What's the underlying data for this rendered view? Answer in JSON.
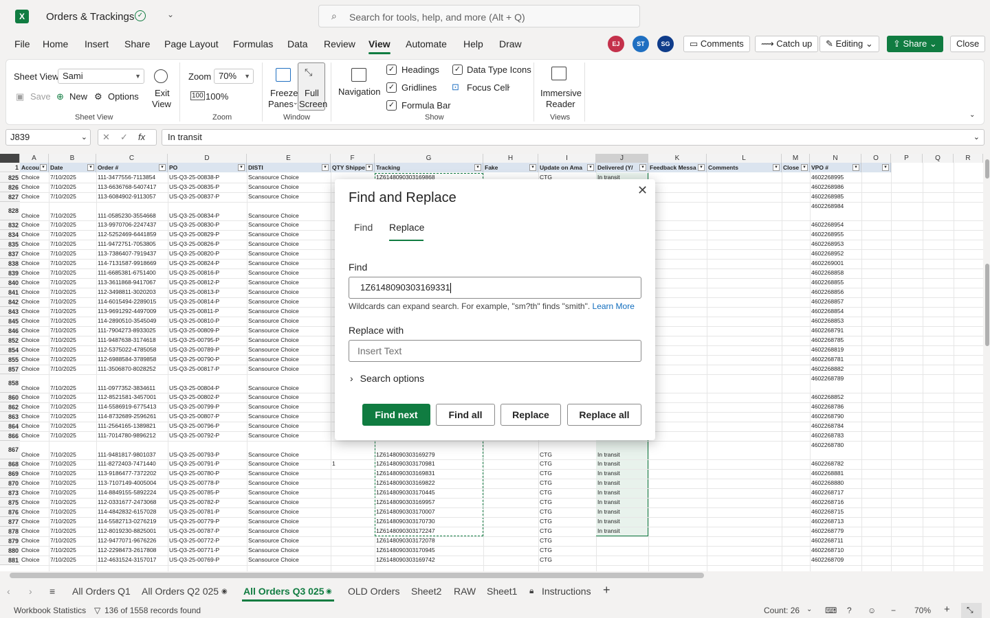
{
  "app": {
    "file_title": "Orders & Trackings",
    "search_placeholder": "Search for tools, help, and more (Alt + Q)"
  },
  "menu": [
    "File",
    "Home",
    "Insert",
    "Share",
    "Page Layout",
    "Formulas",
    "Data",
    "Review",
    "View",
    "Automate",
    "Help",
    "Draw"
  ],
  "active_menu": "View",
  "collaborators": [
    {
      "initials": "EJ",
      "color": "#c4314b"
    },
    {
      "initials": "ST",
      "color": "#1f6fc1"
    },
    {
      "initials": "SG",
      "color": "#0f3c8a"
    }
  ],
  "title_actions": {
    "comments": "Comments",
    "catch_up": "Catch up",
    "editing": "Editing",
    "share": "Share",
    "close": "Close"
  },
  "ribbon": {
    "sheet_view_label": "Sheet View",
    "sheet_view_value": "Sami",
    "save": "Save",
    "new": "New",
    "options": "Options",
    "exit_view": [
      "Exit",
      "View"
    ],
    "sheet_view_group": "Sheet View",
    "zoom_label": "Zoom",
    "zoom_value": "70%",
    "zoom_100": "100%",
    "zoom_group": "Zoom",
    "freeze_panes": [
      "Freeze",
      "Panes"
    ],
    "full_screen": [
      "Full",
      "Screen"
    ],
    "window_group": "Window",
    "navigation": "Navigation",
    "headings": "Headings",
    "gridlines": "Gridlines",
    "formula_bar": "Formula Bar",
    "data_type_icons": "Data Type Icons",
    "focus_cell": "Focus Cell",
    "show_group": "Show",
    "immersive_reader": [
      "Immersive",
      "Reader"
    ],
    "views_group": "Views"
  },
  "formula_bar": {
    "cell_ref": "J839",
    "fx": "fx",
    "value": "In transit"
  },
  "columns": [
    "A",
    "B",
    "C",
    "D",
    "E",
    "F",
    "G",
    "H",
    "I",
    "J",
    "K",
    "L",
    "M",
    "N",
    "O",
    "P",
    "Q",
    "R"
  ],
  "header_row": {
    "row": "1",
    "cells": [
      "Accou",
      "Date",
      "Order #",
      "PO",
      "DISTI",
      "QTY Shippe",
      "Tracking",
      "Fake",
      "Update on Ama",
      "Delivered (Y/",
      "Feedback Messa",
      "Comments",
      "Close",
      "VPO #",
      "",
      "",
      "",
      ""
    ]
  },
  "rows": [
    {
      "n": "825",
      "a": "Choice",
      "b": "7/10/2025",
      "c": "111-3477556-7113854",
      "d": "US-Q3-25-00838-P",
      "e": "Scansource Choice",
      "g": "1Z6148090303169868",
      "i": "CTG",
      "j": "In transit",
      "n2": "4602268995"
    },
    {
      "n": "826",
      "a": "Choice",
      "b": "7/10/2025",
      "c": "113-6636768-5407417",
      "d": "US-Q3-25-00835-P",
      "e": "Scansource Choice",
      "n2": "4602268986"
    },
    {
      "n": "827",
      "a": "Choice",
      "b": "7/10/2025",
      "c": "113-6084902-9113057",
      "d": "US-Q3-25-00837-P",
      "e": "Scansource Choice",
      "n2": "4602268985"
    },
    {
      "n": "828",
      "tall": true,
      "a": "Choice",
      "b": "7/10/2025",
      "c": "111-0585230-3554668",
      "d": "US-Q3-25-00834-P",
      "e": "Scansource Choice",
      "n2": "4602268984"
    },
    {
      "n": "832",
      "a": "Choice",
      "b": "7/10/2025",
      "c": "113-9970706-2247437",
      "d": "US-Q3-25-00830-P",
      "e": "Scansource Choice",
      "n2": "4602268954"
    },
    {
      "n": "834",
      "a": "Choice",
      "b": "7/10/2025",
      "c": "112-5252469-6441859",
      "d": "US-Q3-25-00829-P",
      "e": "Scansource Choice",
      "n2": "4602268955"
    },
    {
      "n": "835",
      "a": "Choice",
      "b": "7/10/2025",
      "c": "111-9472751-7053805",
      "d": "US-Q3-25-00826-P",
      "e": "Scansource Choice",
      "n2": "4602268953"
    },
    {
      "n": "837",
      "a": "Choice",
      "b": "7/10/2025",
      "c": "113-7386407-7919437",
      "d": "US-Q3-25-00820-P",
      "e": "Scansource Choice",
      "n2": "4602268952"
    },
    {
      "n": "838",
      "a": "Choice",
      "b": "7/10/2025",
      "c": "114-7131587-9918669",
      "d": "US-Q3-25-00824-P",
      "e": "Scansource Choice",
      "n2": "4602269001"
    },
    {
      "n": "839",
      "a": "Choice",
      "b": "7/10/2025",
      "c": "111-6685381-6751400",
      "d": "US-Q3-25-00816-P",
      "e": "Scansource Choice",
      "n2": "4602268858"
    },
    {
      "n": "840",
      "a": "Choice",
      "b": "7/10/2025",
      "c": "113-3611868-9417067",
      "d": "US-Q3-25-00812-P",
      "e": "Scansource Choice",
      "n2": "4602268855"
    },
    {
      "n": "841",
      "a": "Choice",
      "b": "7/10/2025",
      "c": "112-3498811-3020203",
      "d": "US-Q3-25-00813-P",
      "e": "Scansource Choice",
      "n2": "4602268856"
    },
    {
      "n": "842",
      "a": "Choice",
      "b": "7/10/2025",
      "c": "114-6015494-2289015",
      "d": "US-Q3-25-00814-P",
      "e": "Scansource Choice",
      "n2": "4602268857"
    },
    {
      "n": "843",
      "a": "Choice",
      "b": "7/10/2025",
      "c": "113-9691292-4497009",
      "d": "US-Q3-25-00811-P",
      "e": "Scansource Choice",
      "n2": "4602268854"
    },
    {
      "n": "845",
      "a": "Choice",
      "b": "7/10/2025",
      "c": "114-2890510-3545049",
      "d": "US-Q3-25-00810-P",
      "e": "Scansource Choice",
      "n2": "4602268853"
    },
    {
      "n": "846",
      "a": "Choice",
      "b": "7/10/2025",
      "c": "111-7904273-8933025",
      "d": "US-Q3-25-00809-P",
      "e": "Scansource Choice",
      "n2": "4602268791"
    },
    {
      "n": "852",
      "a": "Choice",
      "b": "7/10/2025",
      "c": "111-9487638-3174618",
      "d": "US-Q3-25-00795-P",
      "e": "Scansource Choice",
      "n2": "4602268785"
    },
    {
      "n": "854",
      "a": "Choice",
      "b": "7/10/2025",
      "c": "112-5375022-4785058",
      "d": "US-Q3-25-00789-P",
      "e": "Scansource Choice",
      "n2": "4602268819"
    },
    {
      "n": "855",
      "a": "Choice",
      "b": "7/10/2025",
      "c": "112-6988584-3789858",
      "d": "US-Q3-25-00790-P",
      "e": "Scansource Choice",
      "n2": "4602268781"
    },
    {
      "n": "857",
      "a": "Choice",
      "b": "7/10/2025",
      "c": "111-3506870-8028252",
      "d": "US-Q3-25-00817-P",
      "e": "Scansource Choice",
      "n2": "4602268882"
    },
    {
      "n": "858",
      "tall": true,
      "a": "Choice",
      "b": "7/10/2025",
      "c": "111-0977352-3834611",
      "d": "US-Q3-25-00804-P",
      "e": "Scansource Choice",
      "n2": "4602268789"
    },
    {
      "n": "860",
      "a": "Choice",
      "b": "7/10/2025",
      "c": "112-8521581-3457001",
      "d": "US-Q3-25-00802-P",
      "e": "Scansource Choice",
      "n2": "4602268852"
    },
    {
      "n": "862",
      "a": "Choice",
      "b": "7/10/2025",
      "c": "114-5586919-6775413",
      "d": "US-Q3-25-00799-P",
      "e": "Scansource Choice",
      "n2": "4602268786"
    },
    {
      "n": "863",
      "a": "Choice",
      "b": "7/10/2025",
      "c": "114-8732689-2596261",
      "d": "US-Q3-25-00807-P",
      "e": "Scansource Choice",
      "n2": "4602268790"
    },
    {
      "n": "864",
      "a": "Choice",
      "b": "7/10/2025",
      "c": "111-2564165-1389821",
      "d": "US-Q3-25-00796-P",
      "e": "Scansource Choice",
      "n2": "4602268784"
    },
    {
      "n": "866",
      "a": "Choice",
      "b": "7/10/2025",
      "c": "111-7014780-9896212",
      "d": "US-Q3-25-00792-P",
      "e": "Scansource Choice",
      "n2": "4602268783"
    },
    {
      "n": "867",
      "tall": true,
      "a": "Choice",
      "b": "7/10/2025",
      "c": "111-9481817-9801037",
      "d": "US-Q3-25-00793-P",
      "e": "Scansource Choice",
      "g": "1Z6148090303169279",
      "i": "CTG",
      "j": "In transit",
      "n2": "4602268780"
    },
    {
      "n": "868",
      "a": "Choice",
      "b": "7/10/2025",
      "c": "111-8272403-7471440",
      "d": "US-Q3-25-00791-P",
      "e": "Scansource Choice",
      "f": "1",
      "g": "1Z6148090303170981",
      "i": "CTG",
      "j": "In transit",
      "n2": "4602268782"
    },
    {
      "n": "869",
      "a": "Choice",
      "b": "7/10/2025",
      "c": "113-9186477-7372202",
      "d": "US-Q3-25-00780-P",
      "e": "Scansource Choice",
      "g": "1Z6148090303169831",
      "i": "CTG",
      "j": "In transit",
      "n2": "4602268881"
    },
    {
      "n": "870",
      "a": "Choice",
      "b": "7/10/2025",
      "c": "113-7107149-4005004",
      "d": "US-Q3-25-00778-P",
      "e": "Scansource Choice",
      "g": "1Z6148090303169822",
      "i": "CTG",
      "j": "In transit",
      "n2": "4602268880"
    },
    {
      "n": "873",
      "a": "Choice",
      "b": "7/10/2025",
      "c": "114-8849155-5892224",
      "d": "US-Q3-25-00785-P",
      "e": "Scansource Choice",
      "g": "1Z6148090303170445",
      "i": "CTG",
      "j": "In transit",
      "n2": "4602268717"
    },
    {
      "n": "875",
      "a": "Choice",
      "b": "7/10/2025",
      "c": "112-0331677-2473068",
      "d": "US-Q3-25-00782-P",
      "e": "Scansource Choice",
      "g": "1Z6148090303169957",
      "i": "CTG",
      "j": "In transit",
      "n2": "4602268716"
    },
    {
      "n": "876",
      "a": "Choice",
      "b": "7/10/2025",
      "c": "114-4842832-6157028",
      "d": "US-Q3-25-00781-P",
      "e": "Scansource Choice",
      "g": "1Z6148090303170007",
      "i": "CTG",
      "j": "In transit",
      "n2": "4602268715"
    },
    {
      "n": "877",
      "a": "Choice",
      "b": "7/10/2025",
      "c": "114-5582713-0276219",
      "d": "US-Q3-25-00779-P",
      "e": "Scansource Choice",
      "g": "1Z6148090303170730",
      "i": "CTG",
      "j": "In transit",
      "n2": "4602268713"
    },
    {
      "n": "878",
      "a": "Choice",
      "b": "7/10/2025",
      "c": "112-8019230-8825001",
      "d": "US-Q3-25-00787-P",
      "e": "Scansource Choice",
      "g": "1Z6148090303172247",
      "i": "CTG",
      "j": "In transit",
      "n2": "4602268779"
    },
    {
      "n": "879",
      "a": "Choice",
      "b": "7/10/2025",
      "c": "112-9477071-9676226",
      "d": "US-Q3-25-00772-P",
      "e": "Scansource Choice",
      "g": "1Z6148090303172078",
      "i": "CTG",
      "n2": "4602268711"
    },
    {
      "n": "880",
      "a": "Choice",
      "b": "7/10/2025",
      "c": "112-2298473-2617808",
      "d": "US-Q3-25-00771-P",
      "e": "Scansource Choice",
      "g": "1Z6148090303170945",
      "i": "CTG",
      "n2": "4602268710"
    },
    {
      "n": "881",
      "a": "Choice",
      "b": "7/10/2025",
      "c": "112-4631524-3157017",
      "d": "US-Q3-25-00769-P",
      "e": "Scansource Choice",
      "g": "1Z6148090303169742",
      "i": "CTG",
      "n2": "4602268709"
    }
  ],
  "dialog": {
    "title": "Find and Replace",
    "tab_find": "Find",
    "tab_replace": "Replace",
    "find_label": "Find",
    "find_value": "1Z6148090303169331",
    "hint": "Wildcards can expand search. For example, \"sm?th\" finds \"smith\".",
    "learn_more": "Learn More",
    "replace_label": "Replace with",
    "replace_placeholder": "Insert Text",
    "search_options": "Search options",
    "find_next": "Find next",
    "find_all": "Find all",
    "replace": "Replace",
    "replace_all": "Replace all"
  },
  "sheet_tabs": [
    "All Orders Q1",
    "All Orders Q2 025",
    "All Orders Q3 025",
    "OLD Orders",
    "Sheet2",
    "RAW",
    "Sheet1",
    "Instructions"
  ],
  "active_sheet": "All Orders Q3 025",
  "status": {
    "workbook_stats": "Workbook Statistics",
    "records": "136 of 1558 records found",
    "count": "Count: 26",
    "zoom": "70%"
  },
  "colors": {
    "accent": "#107c41",
    "header_fill": "#dbe4ef",
    "selection": "#e8f2ec"
  }
}
